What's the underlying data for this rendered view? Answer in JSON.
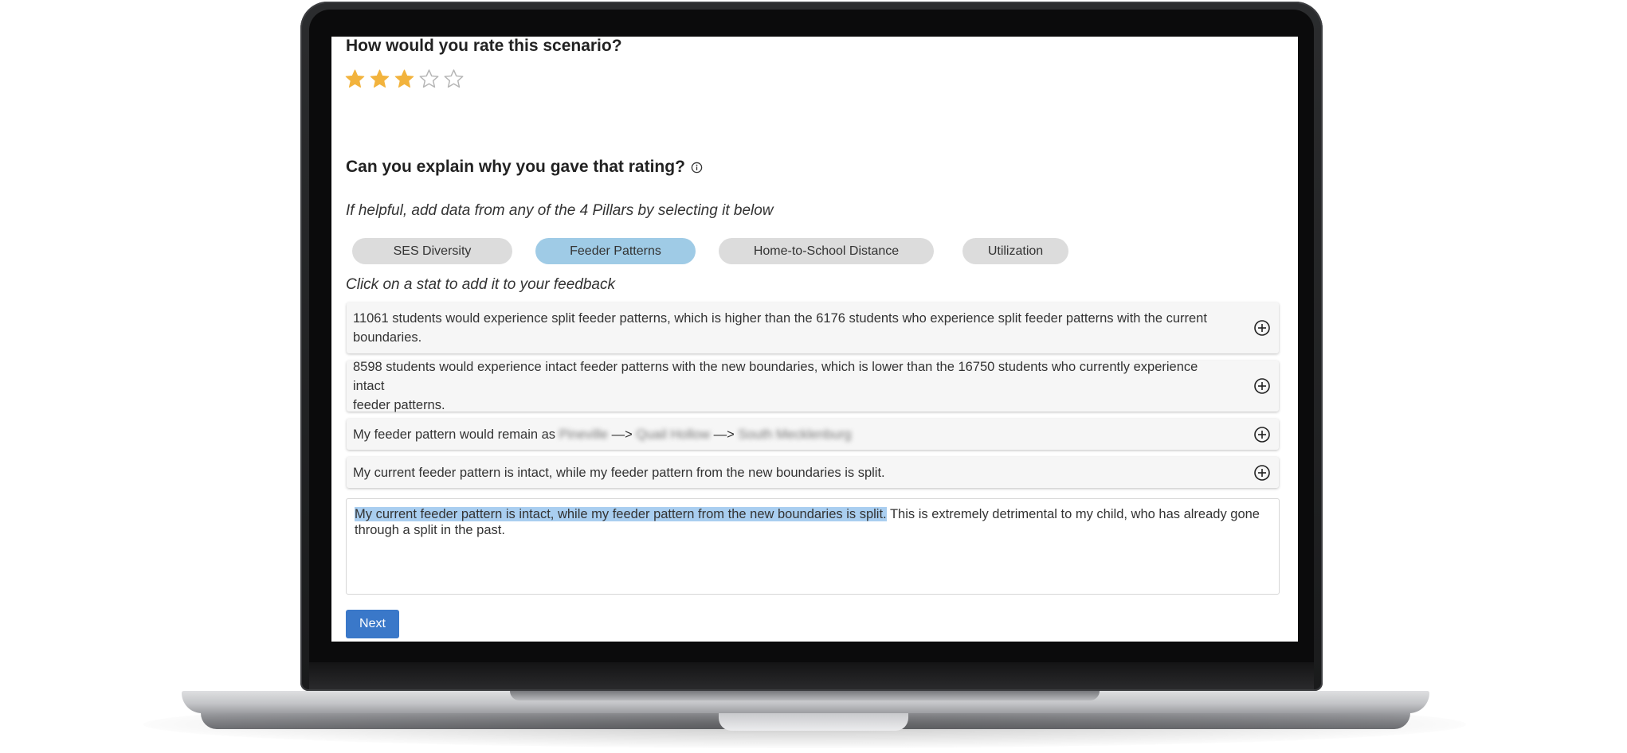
{
  "rating": {
    "question": "How would you rate this scenario?",
    "value": 3,
    "max": 5
  },
  "explain": {
    "question": "Can you explain why you gave that rating?",
    "info_icon": "info-icon"
  },
  "pillars": {
    "hint": "If helpful, add data from any of the 4 Pillars by selecting it below",
    "tabs": [
      {
        "label": "SES Diversity",
        "active": false
      },
      {
        "label": "Feeder Patterns",
        "active": true
      },
      {
        "label": "Home-to-School Distance",
        "active": false
      },
      {
        "label": "Utilization",
        "active": false
      }
    ]
  },
  "stats": {
    "hint": "Click on a stat to add it to your feedback",
    "items": [
      {
        "line1": "11061 students would experience split feeder patterns, which is higher than the 6176 students who experience split feeder patterns with the current",
        "line2": "boundaries.",
        "icon": "add-circle-icon"
      },
      {
        "line1": "8598 students would experience intact feeder patterns with the new boundaries, which is lower than the 16750 students who currently experience intact",
        "line2": "feeder patterns.",
        "icon": "add-circle-icon"
      },
      {
        "prefix": "My feeder pattern would remain as ",
        "school1": "Pineville",
        "arrow1": " —> ",
        "school2": "Quail Hollow",
        "arrow2": " —> ",
        "school3": "South Mecklenburg",
        "icon": "add-circle-icon"
      },
      {
        "line1": "My current feeder pattern is intact, while my feeder pattern from the new boundaries is split.",
        "icon": "add-circle-icon"
      }
    ]
  },
  "feedback": {
    "highlighted": "My current feeder pattern is intact, while my feeder pattern from the new boundaries is split.",
    "rest": " This is extremely detrimental to my child, who has already gone through a split in the past."
  },
  "actions": {
    "next_label": "Next"
  },
  "colors": {
    "star_filled": "#f2b33d",
    "star_empty": "#b5b5b5",
    "pill_active": "#9fcbe6",
    "pill_inactive": "#dcdcdc",
    "highlight": "#a9cef0",
    "button": "#3a78c9"
  }
}
